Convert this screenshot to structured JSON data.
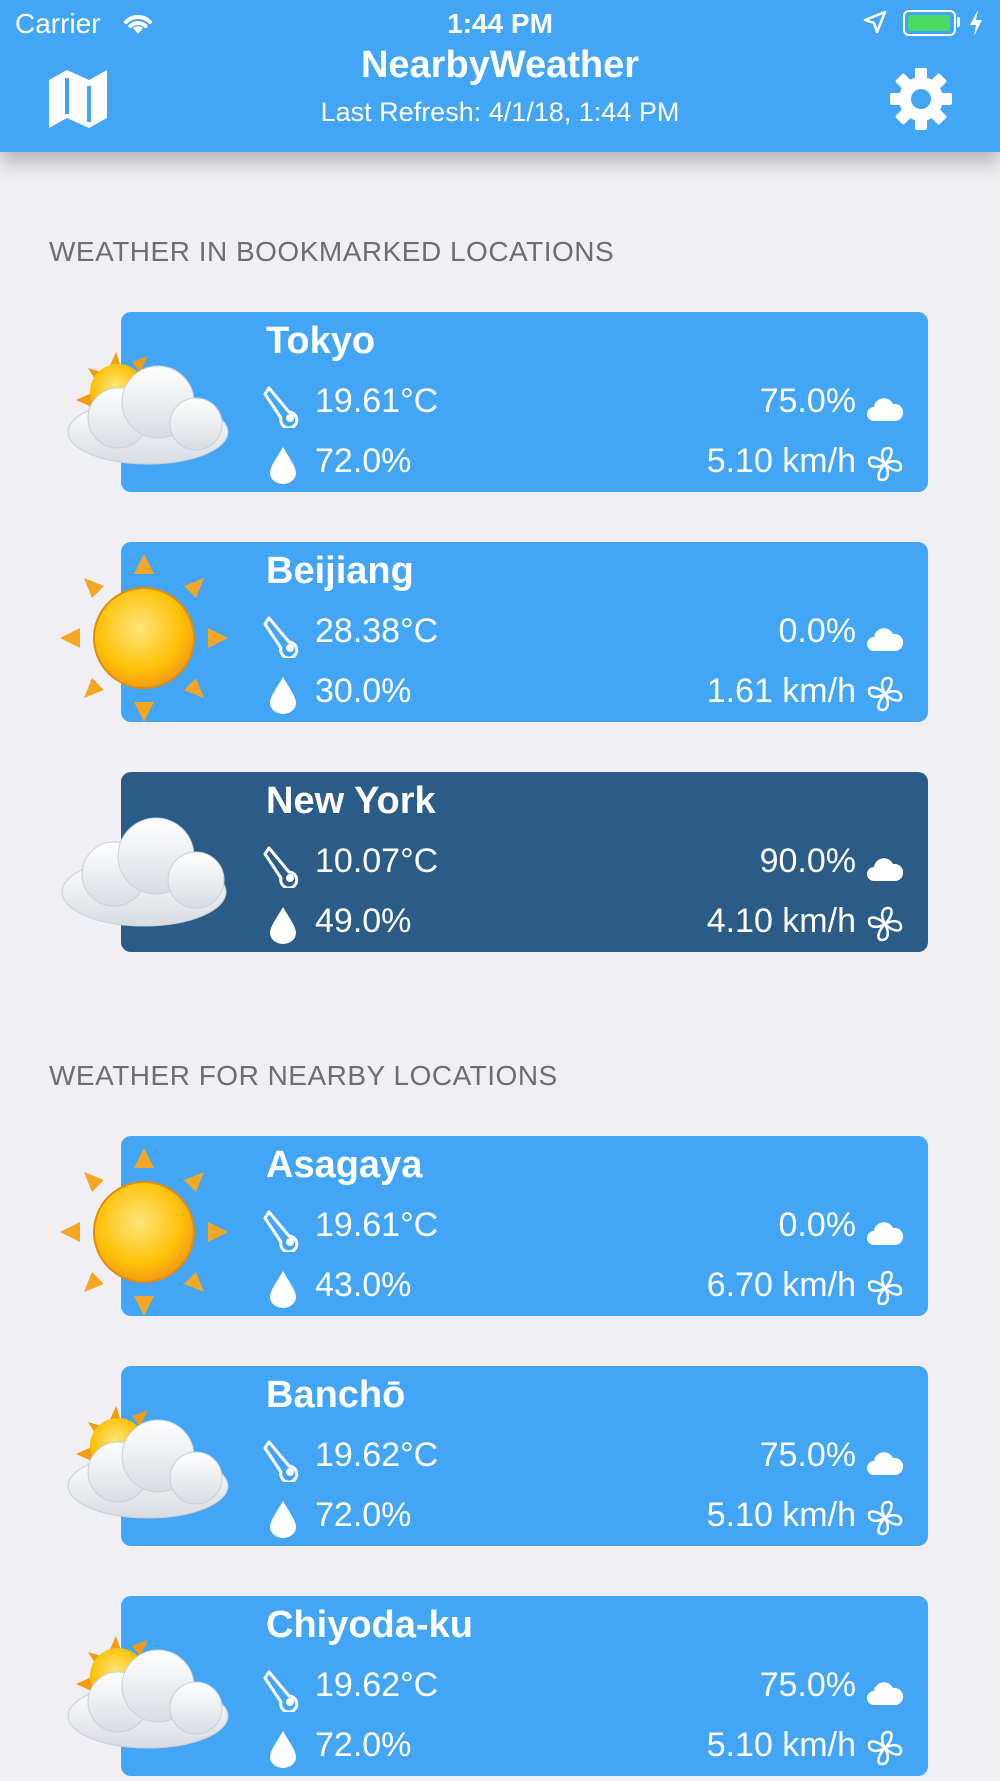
{
  "status_bar": {
    "carrier": "Carrier",
    "time": "1:44 PM"
  },
  "header": {
    "title": "NearbyWeather",
    "subtitle": "Last Refresh: 4/1/18, 1:44 PM"
  },
  "sections": [
    {
      "title": "WEATHER IN BOOKMARKED LOCATIONS",
      "items": [
        {
          "city": "Tokyo",
          "temperature": "19.61°C",
          "cloud_cover": "75.0%",
          "humidity": "72.0%",
          "wind": "5.10 km/h",
          "icon": "sun-behind-cloud-icon",
          "selected": false
        },
        {
          "city": "Beijiang",
          "temperature": "28.38°C",
          "cloud_cover": "0.0%",
          "humidity": "30.0%",
          "wind": "1.61 km/h",
          "icon": "sun-icon",
          "selected": false
        },
        {
          "city": "New York",
          "temperature": "10.07°C",
          "cloud_cover": "90.0%",
          "humidity": "49.0%",
          "wind": "4.10 km/h",
          "icon": "cloud-icon",
          "selected": true
        }
      ]
    },
    {
      "title": "WEATHER FOR NEARBY LOCATIONS",
      "items": [
        {
          "city": "Asagaya",
          "temperature": "19.61°C",
          "cloud_cover": "0.0%",
          "humidity": "43.0%",
          "wind": "6.70 km/h",
          "icon": "sun-icon",
          "selected": false
        },
        {
          "city": "Banchō",
          "temperature": "19.62°C",
          "cloud_cover": "75.0%",
          "humidity": "72.0%",
          "wind": "5.10 km/h",
          "icon": "sun-behind-cloud-icon",
          "selected": false
        },
        {
          "city": "Chiyoda-ku",
          "temperature": "19.62°C",
          "cloud_cover": "75.0%",
          "humidity": "72.0%",
          "wind": "5.10 km/h",
          "icon": "sun-behind-cloud-icon",
          "selected": false
        }
      ]
    }
  ],
  "colors": {
    "header": "#42A5F5",
    "card": "#42A5F5",
    "card_selected": "#2A5C87",
    "background": "#EFEFF4",
    "section_text": "#6D6D72"
  }
}
